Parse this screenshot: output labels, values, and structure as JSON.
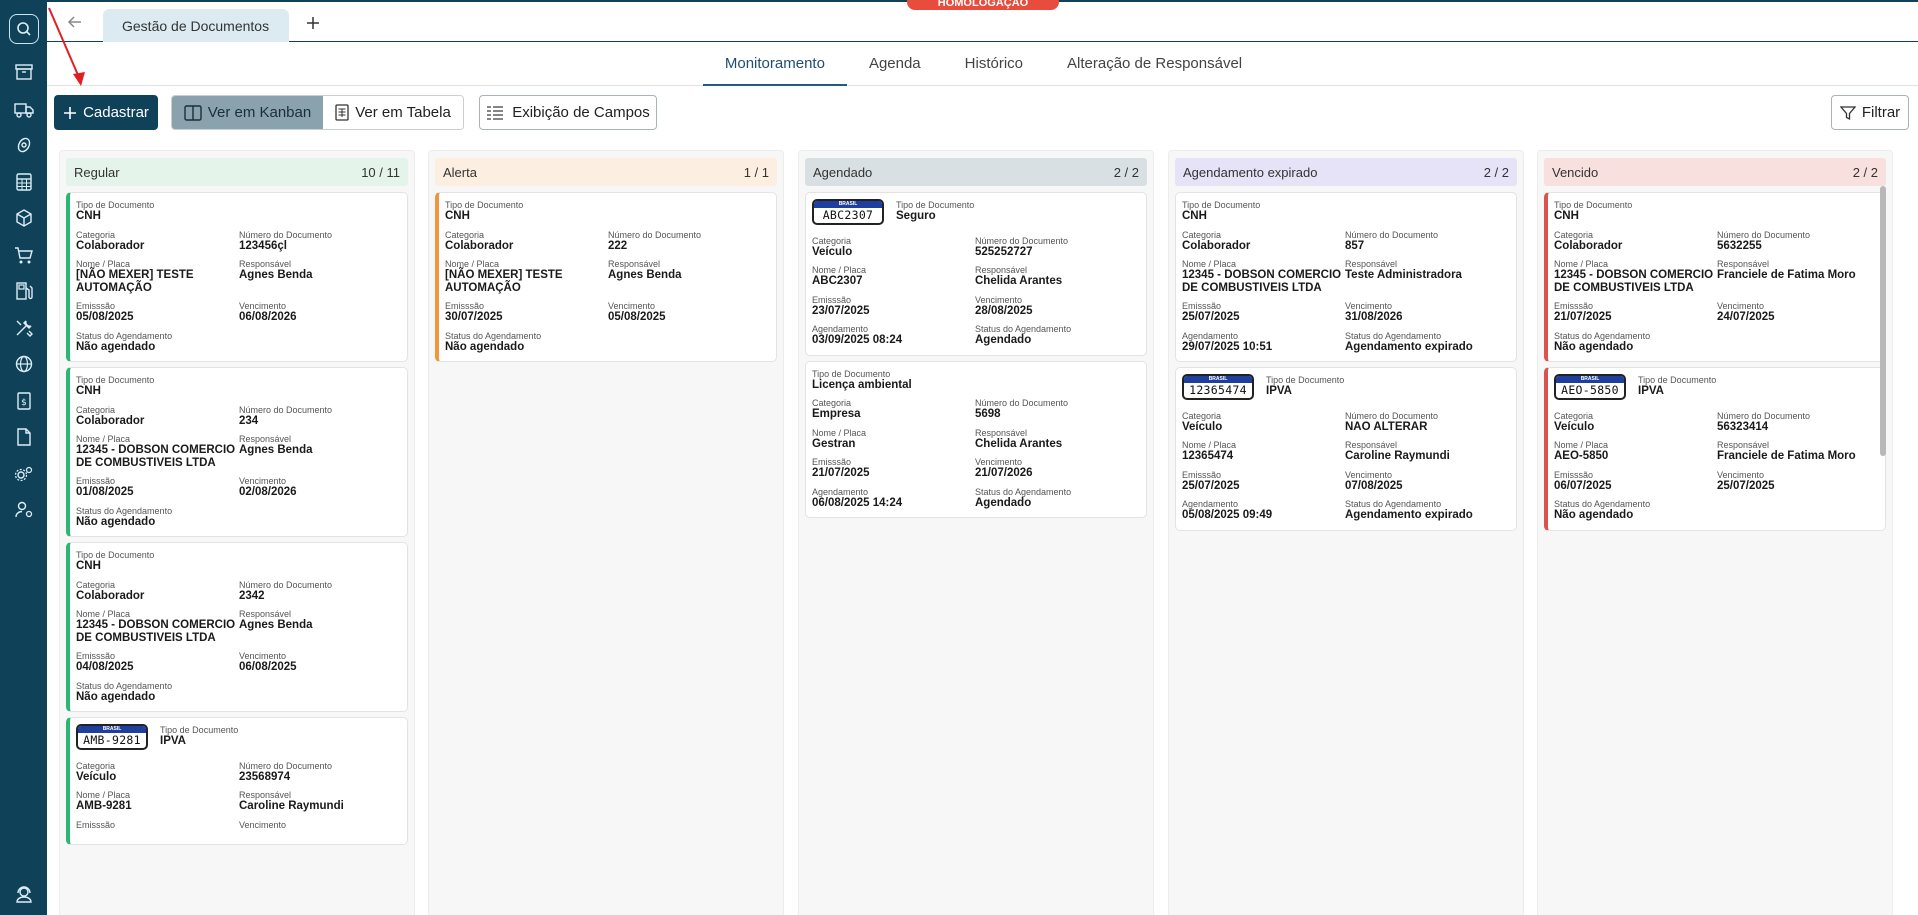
{
  "env_badge": "HOMOLOGAÇÃO",
  "tabs": {
    "active_tab": "Gestão de Documentos"
  },
  "nav": [
    "Monitoramento",
    "Agenda",
    "Histórico",
    "Alteração de Responsável"
  ],
  "toolbar": {
    "cadastrar": "Cadastrar",
    "kanban": "Ver em Kanban",
    "tabela": "Ver em Tabela",
    "campos": "Exibição de Campos",
    "filtrar": "Filtrar"
  },
  "colors": {
    "sidebar": "#0f4259",
    "regular": "#2bb673",
    "alerta": "#f0963c",
    "agendado": "#c8d3d8",
    "expirado": "#d9d3f3",
    "vencido": "#d9534f"
  },
  "labels": {
    "tipo": "Tipo de Documento",
    "categoria": "Categoria",
    "numero": "Número do Documento",
    "nome": "Nome / Placa",
    "responsavel": "Responsável",
    "emissao": "Emisssão",
    "vencimento": "Vencimento",
    "agendamento": "Agendamento",
    "status": "Status do Agendamento",
    "plate_country": "BRASIL"
  },
  "columns": [
    {
      "title": "Regular",
      "count": "10 / 11",
      "cards": [
        {
          "tipo": "CNH",
          "categoria": "Colaborador",
          "numero": "123456çl",
          "nome": "[NÃO MEXER] TESTE AUTOMAÇÃO",
          "responsavel": "Agnes Benda",
          "emissao": "05/08/2025",
          "vencimento": "06/08/2026",
          "status": "Não agendado"
        },
        {
          "tipo": "CNH",
          "categoria": "Colaborador",
          "numero": "234",
          "nome": "12345 - DOBSON COMERCIO DE COMBUSTIVEIS LTDA",
          "responsavel": "Agnes Benda",
          "emissao": "01/08/2025",
          "vencimento": "02/08/2026",
          "status": "Não agendado"
        },
        {
          "tipo": "CNH",
          "categoria": "Colaborador",
          "numero": "2342",
          "nome": "12345 - DOBSON COMERCIO DE COMBUSTIVEIS LTDA",
          "responsavel": "Agnes Benda",
          "emissao": "04/08/2025",
          "vencimento": "06/08/2025",
          "status": "Não agendado"
        },
        {
          "plate": "AMB-9281",
          "tipo": "IPVA",
          "categoria": "Veículo",
          "numero": "23568974",
          "nome": "AMB-9281",
          "responsavel": "Caroline Raymundi",
          "emissao": "",
          "vencimento": ""
        }
      ]
    },
    {
      "title": "Alerta",
      "count": "1 / 1",
      "cards": [
        {
          "tipo": "CNH",
          "categoria": "Colaborador",
          "numero": "222",
          "nome": "[NÃO MEXER] TESTE AUTOMAÇÃO",
          "responsavel": "Agnes Benda",
          "emissao": "30/07/2025",
          "vencimento": "05/08/2025",
          "status": "Não agendado"
        }
      ]
    },
    {
      "title": "Agendado",
      "count": "2 / 2",
      "cards": [
        {
          "plate": "ABC2307",
          "tipo": "Seguro",
          "categoria": "Veículo",
          "numero": "525252727",
          "nome": "ABC2307",
          "responsavel": "Chelida Arantes",
          "emissao": "23/07/2025",
          "vencimento": "28/08/2025",
          "agendamento": "03/09/2025 08:24",
          "status": "Agendado"
        },
        {
          "tipo": "Licença ambiental",
          "categoria": "Empresa",
          "numero": "5698",
          "nome": "Gestran",
          "responsavel": "Chelida Arantes",
          "emissao": "21/07/2025",
          "vencimento": "21/07/2026",
          "agendamento": "06/08/2025 14:24",
          "status": "Agendado"
        }
      ]
    },
    {
      "title": "Agendamento expirado",
      "count": "2 / 2",
      "cards": [
        {
          "tipo": "CNH",
          "categoria": "Colaborador",
          "numero": "857",
          "nome": "12345 - DOBSON COMERCIO DE COMBUSTIVEIS LTDA",
          "responsavel": "Teste Administradora",
          "emissao": "25/07/2025",
          "vencimento": "31/08/2026",
          "agendamento": "29/07/2025 10:51",
          "status": "Agendamento expirado"
        },
        {
          "plate": "12365474",
          "tipo": "IPVA",
          "categoria": "Veículo",
          "numero": "NAO ALTERAR",
          "nome": "12365474",
          "responsavel": "Caroline Raymundi",
          "emissao": "25/07/2025",
          "vencimento": "07/08/2025",
          "agendamento": "05/08/2025 09:49",
          "status": "Agendamento expirado"
        }
      ]
    },
    {
      "title": "Vencido",
      "count": "2 / 2",
      "cards": [
        {
          "tipo": "CNH",
          "categoria": "Colaborador",
          "numero": "5632255",
          "nome": "12345 - DOBSON COMERCIO DE COMBUSTIVEIS LTDA",
          "responsavel": "Franciele de Fatima Moro",
          "emissao": "21/07/2025",
          "vencimento": "24/07/2025",
          "status": "Não agendado"
        },
        {
          "plate": "AEO-5850",
          "tipo": "IPVA",
          "categoria": "Veículo",
          "numero": "56323414",
          "nome": "AEO-5850",
          "responsavel": "Franciele de Fatima Moro",
          "emissao": "06/07/2025",
          "vencimento": "25/07/2025",
          "status": "Não agendado"
        }
      ]
    }
  ]
}
